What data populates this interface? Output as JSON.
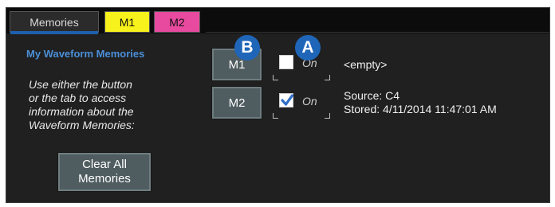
{
  "tabs": [
    {
      "label": "Memories",
      "active": true
    },
    {
      "label": "M1",
      "color": "#f7f21b"
    },
    {
      "label": "M2",
      "color": "#e74a9e"
    }
  ],
  "section_title": "My Waveform Memories",
  "help_lines": [
    "Use either the button",
    "or the tab to access",
    "information about the",
    "Waveform Memories:"
  ],
  "clear_button": {
    "line1": "Clear All",
    "line2": "Memories"
  },
  "memories": [
    {
      "button_label": "M1",
      "on_label": "On",
      "checked": false,
      "status": "<empty>"
    },
    {
      "button_label": "M2",
      "on_label": "On",
      "checked": true,
      "source": "Source: C4",
      "stored": "Stored: 4/11/2014 11:47:01 AM"
    }
  ],
  "callouts": {
    "a": "A",
    "b": "B"
  },
  "colors": {
    "accent": "#4a8fd8",
    "marker": "#1f66b8",
    "check": "#2f6fc9"
  }
}
